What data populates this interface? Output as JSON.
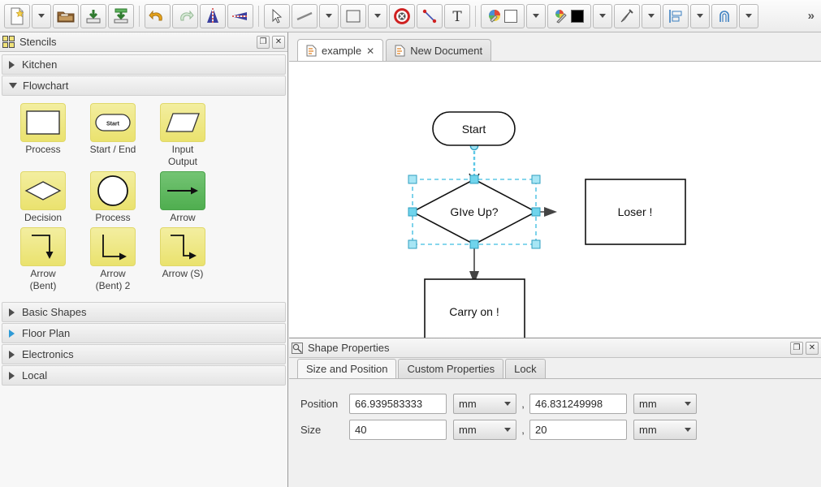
{
  "toolbar": {
    "buttons": [
      {
        "name": "new-document-button",
        "icon": "new-document-icon",
        "title": "New"
      },
      {
        "name": "new-document-dropdown",
        "icon": "chevron-down-icon",
        "title": "New options"
      },
      {
        "name": "open-button",
        "icon": "folder-open-icon",
        "title": "Open"
      },
      {
        "name": "save-button",
        "icon": "save-icon",
        "title": "Save"
      },
      {
        "name": "save-as-button",
        "icon": "save-as-icon",
        "title": "Save As"
      },
      {
        "name": "undo-button",
        "icon": "undo-icon",
        "title": "Undo"
      },
      {
        "name": "redo-button",
        "icon": "redo-icon",
        "title": "Redo"
      },
      {
        "name": "flip-vertical-button",
        "icon": "flip-vertical-icon",
        "title": "Flip Vertical"
      },
      {
        "name": "flip-horizontal-button",
        "icon": "flip-horizontal-icon",
        "title": "Flip Horizontal"
      },
      {
        "name": "pointer-tool-button",
        "icon": "pointer-icon",
        "title": "Select"
      },
      {
        "name": "line-tool-button",
        "icon": "line-icon",
        "title": "Line"
      },
      {
        "name": "line-tool-dropdown",
        "icon": "chevron-down-icon",
        "title": "Line options"
      },
      {
        "name": "rectangle-tool-button",
        "icon": "rectangle-icon",
        "title": "Rectangle"
      },
      {
        "name": "rectangle-tool-dropdown",
        "icon": "chevron-down-icon",
        "title": "Shape options"
      },
      {
        "name": "delete-button",
        "icon": "delete-circle-icon",
        "title": "Delete"
      },
      {
        "name": "connector-tool-button",
        "icon": "connector-icon",
        "title": "Connector"
      },
      {
        "name": "text-tool-button",
        "icon": "text-icon",
        "title": "Text"
      },
      {
        "name": "fill-color-button",
        "icon": "fill-color-icon",
        "title": "Fill Color"
      },
      {
        "name": "fill-color-dropdown",
        "icon": "chevron-down-icon",
        "title": "Fill Color options"
      },
      {
        "name": "line-color-button",
        "icon": "line-color-icon",
        "title": "Line Color"
      },
      {
        "name": "line-color-dropdown",
        "icon": "chevron-down-icon",
        "title": "Line Color options"
      },
      {
        "name": "line-style-button",
        "icon": "pen-icon",
        "title": "Line Style"
      },
      {
        "name": "line-style-dropdown",
        "icon": "chevron-down-icon",
        "title": "Line Style options"
      },
      {
        "name": "align-button",
        "icon": "align-icon",
        "title": "Align"
      },
      {
        "name": "align-dropdown",
        "icon": "chevron-down-icon",
        "title": "Align options"
      },
      {
        "name": "arc-button",
        "icon": "arc-icon",
        "title": "Arc"
      },
      {
        "name": "arc-dropdown",
        "icon": "chevron-down-icon",
        "title": "Arc options"
      }
    ],
    "overflow_label": "»",
    "fill_swatch_color": "#ffffff",
    "line_swatch_color": "#000000"
  },
  "stencils": {
    "panel_title": "Stencils",
    "panel_icon": "stencils-grid-icon",
    "float_button_label": "❐",
    "close_button_label": "✕",
    "categories": [
      {
        "label": "Kitchen",
        "expanded": false,
        "highlighted": false
      },
      {
        "label": "Flowchart",
        "expanded": true,
        "highlighted": false
      },
      {
        "label": "Basic Shapes",
        "expanded": false,
        "highlighted": false
      },
      {
        "label": "Floor Plan",
        "expanded": false,
        "highlighted": true
      },
      {
        "label": "Electronics",
        "expanded": false,
        "highlighted": false
      },
      {
        "label": "Local",
        "expanded": false,
        "highlighted": false
      }
    ],
    "shapes": [
      {
        "label": "Process",
        "icon": "process-rectangle-icon",
        "tile": "yellow"
      },
      {
        "label": "Start / End",
        "icon": "start-end-oval-icon",
        "tile": "yellow",
        "inner_text": "Start"
      },
      {
        "label": "Input\nOutput",
        "icon": "input-output-parallelogram-icon",
        "tile": "yellow"
      },
      {
        "label": "Decision",
        "icon": "decision-diamond-icon",
        "tile": "yellow"
      },
      {
        "label": "Process",
        "icon": "process-circle-icon",
        "tile": "yellow"
      },
      {
        "label": "Arrow",
        "icon": "arrow-straight-icon",
        "tile": "green"
      },
      {
        "label": "Arrow\n(Bent)",
        "icon": "arrow-bent-icon",
        "tile": "yellow"
      },
      {
        "label": "Arrow\n(Bent) 2",
        "icon": "arrow-bent-2-icon",
        "tile": "yellow"
      },
      {
        "label": "Arrow (S)",
        "icon": "arrow-s-icon",
        "tile": "yellow"
      }
    ]
  },
  "tabs": [
    {
      "label": "example",
      "icon": "document-icon",
      "closable": true,
      "close_label": "✕",
      "active": true
    },
    {
      "label": "New Document",
      "icon": "document-icon",
      "closable": false,
      "close_label": "",
      "active": false
    }
  ],
  "canvas": {
    "nodes": [
      {
        "name": "start-node",
        "shape": "rounded-oval",
        "text": "Start"
      },
      {
        "name": "decision-node",
        "shape": "diamond",
        "text": "GIve Up?",
        "selected": true
      },
      {
        "name": "loser-node",
        "shape": "rectangle",
        "text": "Loser !"
      },
      {
        "name": "carry-on-node",
        "shape": "rectangle",
        "text": "Carry on !"
      }
    ],
    "connectors": [
      {
        "name": "connector-start-to-decision",
        "selected": true
      },
      {
        "name": "connector-decision-to-loser",
        "selected": false
      },
      {
        "name": "connector-decision-to-carry-on",
        "selected": false
      },
      {
        "name": "connector-carry-on-down",
        "selected": false
      }
    ],
    "selection_color": "#7fd8ef",
    "shape_stroke_color": "#000000"
  },
  "properties": {
    "panel_title": "Shape Properties",
    "panel_icon": "shape-properties-icon",
    "float_button_label": "❐",
    "close_button_label": "✕",
    "tabs": [
      {
        "label": "Size and Position",
        "active": true
      },
      {
        "label": "Custom Properties",
        "active": false
      },
      {
        "label": "Lock",
        "active": false
      }
    ],
    "fields": {
      "position_label": "Position",
      "position_x_value": "66.939583333",
      "position_x_unit": "mm",
      "position_y_value": "46.831249998",
      "position_y_unit": "mm",
      "size_label": "Size",
      "size_w_value": "40",
      "size_w_unit": "mm",
      "size_h_value": "20",
      "size_h_unit": "mm",
      "separator": ","
    }
  }
}
